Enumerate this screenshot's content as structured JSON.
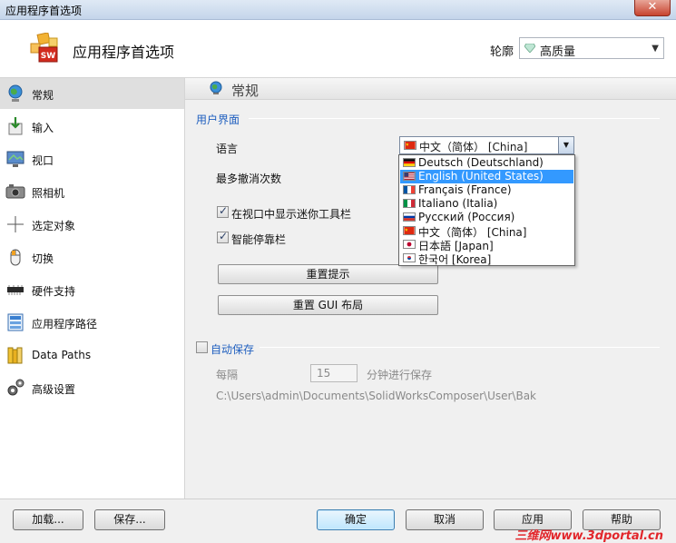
{
  "window": {
    "title": "应用程序首选项",
    "close_glyph": "✕"
  },
  "header": {
    "app_title": "应用程序首选项",
    "profile_label": "轮廓",
    "profile_value": "高质量"
  },
  "sidebar": {
    "items": [
      {
        "label": "常规",
        "icon": "globe-icon",
        "active": true
      },
      {
        "label": "输入",
        "icon": "import-icon"
      },
      {
        "label": "视口",
        "icon": "viewport-icon"
      },
      {
        "label": "照相机",
        "icon": "camera-icon"
      },
      {
        "label": "选定对象",
        "icon": "crosshair-icon"
      },
      {
        "label": "切换",
        "icon": "mouse-icon"
      },
      {
        "label": "硬件支持",
        "icon": "chip-icon"
      },
      {
        "label": "应用程序路径",
        "icon": "paths-icon"
      },
      {
        "label": "Data Paths",
        "icon": "books-icon"
      },
      {
        "label": "高级设置",
        "icon": "gears-icon"
      }
    ]
  },
  "section": {
    "title": "常规",
    "icon": "globe-icon"
  },
  "ui_group": {
    "title": "用户界面",
    "language_label": "语言",
    "language_value": "中文（简体） [China]",
    "undo_label": "最多撤消次数",
    "mini_toolbar_label": "在视口中显示迷你工具栏",
    "mini_toolbar_checked": true,
    "smart_dock_label": "智能停靠栏",
    "smart_dock_checked": true,
    "reset_tips_label": "重置提示",
    "reset_gui_label": "重置 GUI 布局"
  },
  "language_dropdown": {
    "options": [
      {
        "label": "Deutsch (Deutschland)",
        "flag": "de"
      },
      {
        "label": "English (United States)",
        "flag": "us",
        "highlighted": true
      },
      {
        "label": "Français (France)",
        "flag": "fr"
      },
      {
        "label": "Italiano (Italia)",
        "flag": "it"
      },
      {
        "label": "Русский (Россия)",
        "flag": "ru"
      },
      {
        "label": "中文（简体） [China]",
        "flag": "cn"
      },
      {
        "label": "日本語 [Japan]",
        "flag": "jp"
      },
      {
        "label": "한국어 [Korea]",
        "flag": "kr"
      }
    ]
  },
  "autosave": {
    "title": "自动保存",
    "checked": false,
    "every_label": "每隔",
    "interval_value": "15",
    "unit_label": "分钟进行保存",
    "path": "C:\\Users\\admin\\Documents\\SolidWorksComposer\\User\\Bak"
  },
  "footer": {
    "load_label": "加载...",
    "save_label": "保存...",
    "ok_label": "确定",
    "cancel_label": "取消",
    "apply_label": "应用",
    "help_label": "帮助",
    "watermark": "三维网www.3dportal.cn"
  },
  "colors": {
    "group_title": "#1f5fbf",
    "selection": "#3399ff",
    "watermark": "#e2262b"
  }
}
